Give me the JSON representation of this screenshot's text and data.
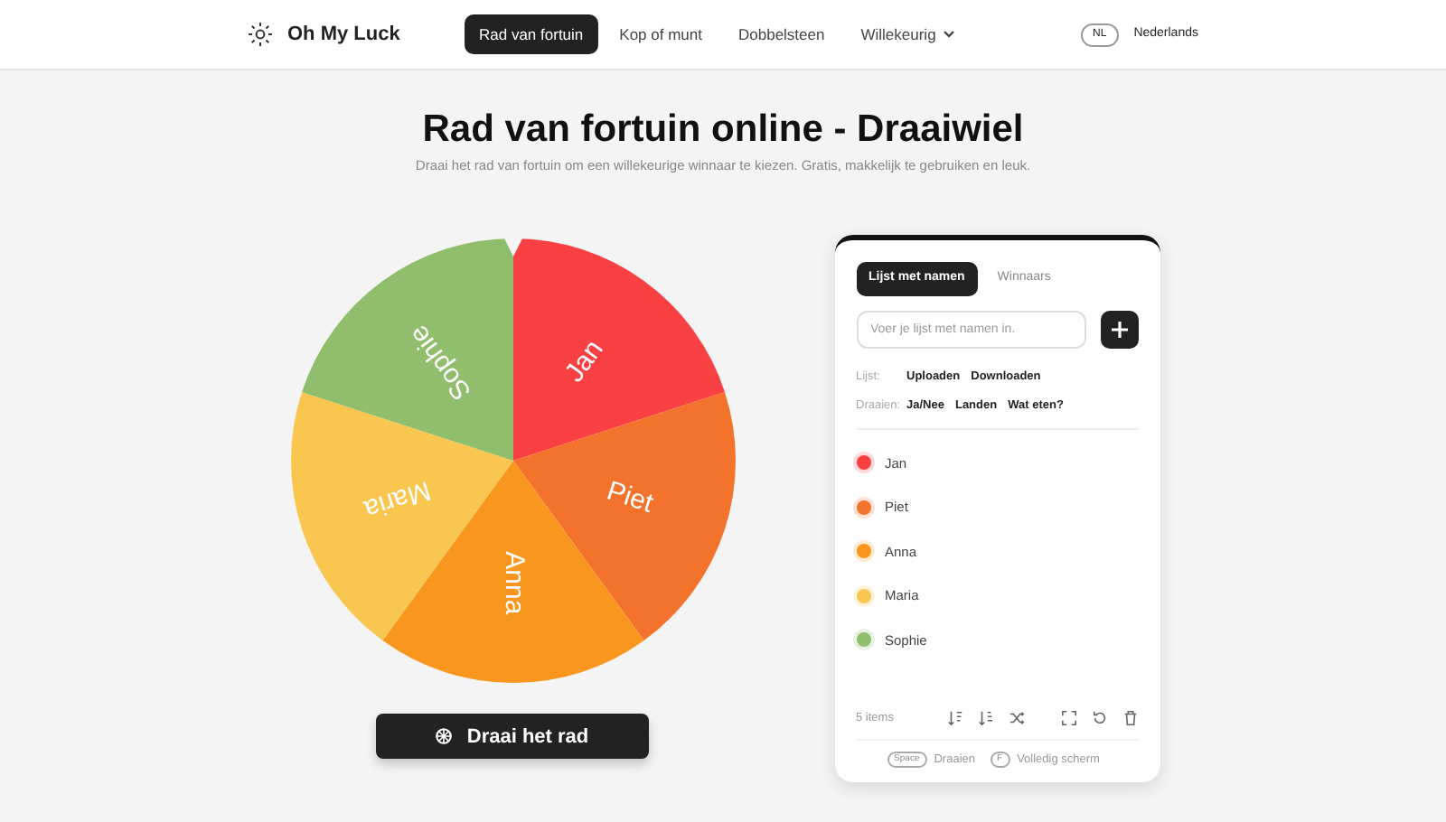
{
  "brand": "Oh My Luck",
  "nav": [
    {
      "label": "Rad van fortuin",
      "selected": true
    },
    {
      "label": "Kop of munt",
      "selected": false
    },
    {
      "label": "Dobbelsteen",
      "selected": false
    },
    {
      "label": "Willekeurig",
      "selected": false,
      "dropdown": true
    }
  ],
  "language": {
    "code": "NL",
    "label": "Nederlands"
  },
  "title": "Rad van fortuin online - Draaiwiel",
  "subtitle": "Draai het rad van fortuin om een willekeurige winnaar te kiezen. Gratis, makkelijk te gebruiken en leuk.",
  "wheel_slices": [
    {
      "label": "Jan",
      "color": "#f94144"
    },
    {
      "label": "Piet",
      "color": "#f3722c"
    },
    {
      "label": "Anna",
      "color": "#f8961e"
    },
    {
      "label": "Maria",
      "color": "#f9c74f"
    },
    {
      "label": "Sophie",
      "color": "#90be6d"
    }
  ],
  "spin_button": "Draai het rad",
  "tabs": [
    {
      "label": "Lijst met namen",
      "selected": true
    },
    {
      "label": "Winnaars",
      "selected": false
    }
  ],
  "input": {
    "placeholder": "Voer je lijst met namen in."
  },
  "link_rows": [
    {
      "label": "Lijst:",
      "links": [
        "Uploaden",
        "Downloaden"
      ]
    },
    {
      "label": "Draaien:",
      "links": [
        "Ja/Nee",
        "Landen",
        "Wat eten?"
      ]
    }
  ],
  "entries": [
    {
      "name": "Jan",
      "color": "#f94144"
    },
    {
      "name": "Piet",
      "color": "#f3722c"
    },
    {
      "name": "Anna",
      "color": "#f8961e"
    },
    {
      "name": "Maria",
      "color": "#f9c74f"
    },
    {
      "name": "Sophie",
      "color": "#90be6d"
    }
  ],
  "count": "5 items",
  "shortcuts": [
    {
      "key": "Space",
      "label": "Draaien"
    },
    {
      "key": "F",
      "label": "Volledig scherm"
    }
  ]
}
